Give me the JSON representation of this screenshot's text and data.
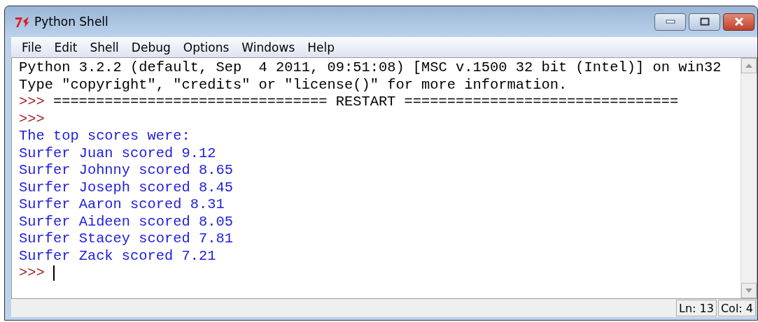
{
  "window": {
    "title": "Python Shell"
  },
  "menu": [
    "File",
    "Edit",
    "Shell",
    "Debug",
    "Options",
    "Windows",
    "Help"
  ],
  "lines": [
    {
      "kind": "output",
      "text": "Python 3.2.2 (default, Sep  4 2011, 09:51:08) [MSC v.1500 32 bit (Intel)] on win32"
    },
    {
      "kind": "output",
      "text": "Type \"copyright\", \"credits\" or \"license()\" for more information."
    },
    {
      "kind": "prompt",
      "prompt": ">>>",
      "text": "================================ RESTART ================================"
    },
    {
      "kind": "prompt",
      "prompt": ">>>"
    },
    {
      "kind": "stdout",
      "text": "The top scores were:"
    },
    {
      "kind": "stdout",
      "text": "Surfer Juan scored 9.12"
    },
    {
      "kind": "stdout",
      "text": "Surfer Johnny scored 8.65"
    },
    {
      "kind": "stdout",
      "text": "Surfer Joseph scored 8.45"
    },
    {
      "kind": "stdout",
      "text": "Surfer Aaron scored 8.31"
    },
    {
      "kind": "stdout",
      "text": "Surfer Aideen scored 8.05"
    },
    {
      "kind": "stdout",
      "text": "Surfer Stacey scored 7.81"
    },
    {
      "kind": "stdout",
      "text": "Surfer Zack scored 7.21"
    },
    {
      "kind": "input",
      "prompt": ">>>"
    }
  ],
  "status_bar": {
    "line": "Ln: 13",
    "col": "Col: 4"
  }
}
